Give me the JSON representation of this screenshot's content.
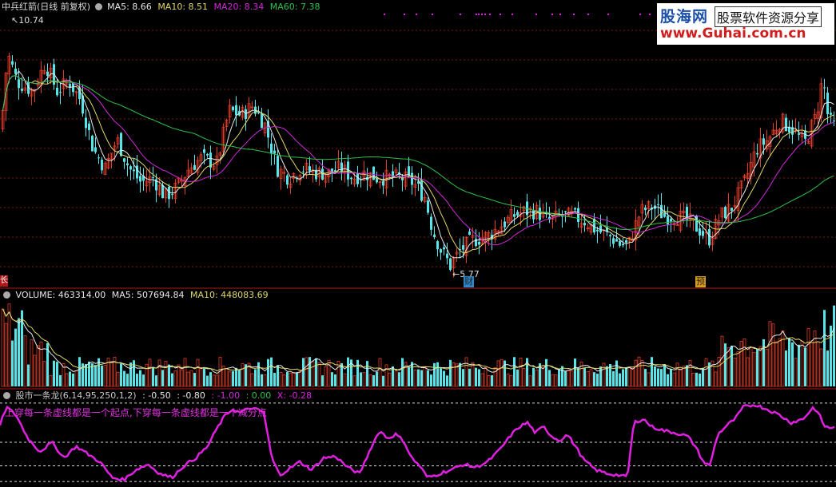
{
  "colors": {
    "background": "#000000",
    "up": "#e03e2a",
    "down": "#56e6ea",
    "ma5": "#e8e8e8",
    "ma10": "#e0d96a",
    "ma20": "#d02ad6",
    "ma60": "#2ec24a",
    "grid": "#7a1a1a",
    "divider": "#b01818",
    "indicator": "#e020e0",
    "text_gray": "#c8c8c8"
  },
  "price_panel": {
    "title": "中兵红箭(日线 前复权)",
    "ma5_label": "MA5: 8.66",
    "ma10_label": "MA10: 8.51",
    "ma20_label": "MA20: 8.34",
    "ma60_label": "MA60: 7.38",
    "high_marker": "10.74",
    "low_marker": "5.77",
    "event_cai": "财",
    "event_yu": "预",
    "corner_mark": "长"
  },
  "volume_panel": {
    "volume_label": "VOLUME: 463314.00",
    "ma5_label": "MA5: 507694.84",
    "ma10_label": "MA10: 448083.69"
  },
  "indicator_panel": {
    "name": "股市一条龙(6,14,95,250,1,2)",
    "v1": ": -0.50",
    "v2": ": -0.80",
    "v3": ": -1.00",
    "v4": ": 0.00",
    "v5": "X: -0.28",
    "note": "上穿每一条虚线都是一个起点,下穿每一条虚线都是一个减分点"
  },
  "watermark": {
    "title": "股海网",
    "slogan": "股票软件资源分享",
    "url": "www.Guhai.com.cn"
  },
  "icons": [
    "panel-toggle-icon",
    "panel-toggle-icon",
    "panel-toggle-icon"
  ],
  "chart_data": [
    {
      "type": "candlestick",
      "title": "中兵红箭(日线 前复权)",
      "series": [
        {
          "name": "MA5",
          "last": 8.66
        },
        {
          "name": "MA10",
          "last": 8.51
        },
        {
          "name": "MA20",
          "last": 8.34
        },
        {
          "name": "MA60",
          "last": 7.38
        }
      ],
      "annotations": [
        {
          "label": "10.74",
          "value": 10.74
        },
        {
          "label": "5.77",
          "value": 5.77
        }
      ],
      "anchors": [
        [
          0,
          8.6
        ],
        [
          8,
          10.2
        ],
        [
          20,
          9.6
        ],
        [
          40,
          9.4
        ],
        [
          55,
          10.0
        ],
        [
          70,
          9.4
        ],
        [
          85,
          9.6
        ],
        [
          100,
          9.2
        ],
        [
          115,
          8.2
        ],
        [
          130,
          7.8
        ],
        [
          145,
          8.4
        ],
        [
          160,
          7.8
        ],
        [
          175,
          7.5
        ],
        [
          190,
          7.6
        ],
        [
          205,
          7.2
        ],
        [
          220,
          7.4
        ],
        [
          235,
          7.8
        ],
        [
          250,
          8.0
        ],
        [
          270,
          7.9
        ],
        [
          285,
          9.0
        ],
        [
          300,
          8.9
        ],
        [
          315,
          9.1
        ],
        [
          330,
          8.7
        ],
        [
          345,
          7.8
        ],
        [
          360,
          7.6
        ],
        [
          375,
          7.8
        ],
        [
          395,
          7.7
        ],
        [
          410,
          7.7
        ],
        [
          425,
          7.8
        ],
        [
          440,
          7.6
        ],
        [
          455,
          7.7
        ],
        [
          470,
          7.6
        ],
        [
          485,
          7.6
        ],
        [
          500,
          7.6
        ],
        [
          515,
          7.5
        ],
        [
          530,
          7.2
        ],
        [
          540,
          6.5
        ],
        [
          550,
          6.1
        ],
        [
          562,
          5.77
        ],
        [
          575,
          6.1
        ],
        [
          590,
          6.3
        ],
        [
          610,
          6.4
        ],
        [
          625,
          6.6
        ],
        [
          640,
          6.8
        ],
        [
          655,
          6.9
        ],
        [
          670,
          6.9
        ],
        [
          685,
          6.7
        ],
        [
          700,
          6.8
        ],
        [
          715,
          6.8
        ],
        [
          730,
          6.7
        ],
        [
          745,
          6.5
        ],
        [
          760,
          6.4
        ],
        [
          775,
          6.2
        ],
        [
          785,
          6.2
        ],
        [
          800,
          6.9
        ],
        [
          815,
          7.0
        ],
        [
          830,
          6.8
        ],
        [
          845,
          6.8
        ],
        [
          860,
          6.7
        ],
        [
          875,
          6.5
        ],
        [
          885,
          6.3
        ],
        [
          900,
          6.8
        ],
        [
          915,
          7.0
        ],
        [
          930,
          7.5
        ],
        [
          945,
          8.2
        ],
        [
          960,
          8.4
        ],
        [
          975,
          8.8
        ],
        [
          990,
          8.6
        ],
        [
          1005,
          8.3
        ],
        [
          1020,
          8.9
        ],
        [
          1028,
          9.7
        ],
        [
          1035,
          8.8
        ],
        [
          1046,
          8.6
        ]
      ],
      "ylim": [
        5.4,
        11.0
      ]
    },
    {
      "type": "bar",
      "title": "VOLUME",
      "series": [
        {
          "name": "VOLUME",
          "last": 463314.0
        },
        {
          "name": "MA5",
          "last": 507694.84
        },
        {
          "name": "MA10",
          "last": 448083.69
        }
      ]
    },
    {
      "type": "line",
      "title": "股市一条龙(6,14,95,250,1,2)",
      "series": [
        {
          "name": "X",
          "last": -0.28
        }
      ],
      "ylim": [
        -1.05,
        0.05
      ],
      "levels": [
        0.0,
        -0.5,
        -0.8,
        -1.0
      ],
      "anchors": [
        [
          0,
          -0.28
        ],
        [
          8,
          -0.05
        ],
        [
          20,
          -0.15
        ],
        [
          35,
          -0.45
        ],
        [
          50,
          -0.62
        ],
        [
          65,
          -0.5
        ],
        [
          80,
          -0.7
        ],
        [
          95,
          -0.55
        ],
        [
          110,
          -0.65
        ],
        [
          125,
          -0.75
        ],
        [
          140,
          -0.95
        ],
        [
          155,
          -0.98
        ],
        [
          170,
          -0.85
        ],
        [
          185,
          -0.78
        ],
        [
          200,
          -0.9
        ],
        [
          215,
          -0.95
        ],
        [
          230,
          -0.8
        ],
        [
          245,
          -0.7
        ],
        [
          260,
          -0.55
        ],
        [
          270,
          -0.35
        ],
        [
          280,
          -0.18
        ],
        [
          290,
          -0.08
        ],
        [
          300,
          -0.12
        ],
        [
          315,
          -0.06
        ],
        [
          330,
          -0.12
        ],
        [
          340,
          -0.7
        ],
        [
          350,
          -0.92
        ],
        [
          360,
          -0.85
        ],
        [
          375,
          -0.75
        ],
        [
          390,
          -0.85
        ],
        [
          405,
          -0.7
        ],
        [
          420,
          -0.68
        ],
        [
          435,
          -0.82
        ],
        [
          450,
          -0.9
        ],
        [
          465,
          -0.55
        ],
        [
          475,
          -0.35
        ],
        [
          485,
          -0.45
        ],
        [
          495,
          -0.4
        ],
        [
          505,
          -0.48
        ],
        [
          515,
          -0.7
        ],
        [
          525,
          -0.8
        ],
        [
          535,
          -0.95
        ],
        [
          545,
          -0.92
        ],
        [
          555,
          -0.88
        ],
        [
          565,
          -0.85
        ],
        [
          580,
          -0.78
        ],
        [
          595,
          -0.82
        ],
        [
          610,
          -0.75
        ],
        [
          625,
          -0.6
        ],
        [
          640,
          -0.4
        ],
        [
          650,
          -0.3
        ],
        [
          660,
          -0.25
        ],
        [
          670,
          -0.38
        ],
        [
          680,
          -0.3
        ],
        [
          690,
          -0.42
        ],
        [
          700,
          -0.48
        ],
        [
          710,
          -0.4
        ],
        [
          720,
          -0.55
        ],
        [
          730,
          -0.72
        ],
        [
          745,
          -0.85
        ],
        [
          760,
          -0.9
        ],
        [
          775,
          -0.92
        ],
        [
          785,
          -0.95
        ],
        [
          793,
          -0.25
        ],
        [
          805,
          -0.2
        ],
        [
          815,
          -0.3
        ],
        [
          830,
          -0.35
        ],
        [
          845,
          -0.38
        ],
        [
          860,
          -0.42
        ],
        [
          870,
          -0.55
        ],
        [
          880,
          -0.75
        ],
        [
          888,
          -0.8
        ],
        [
          898,
          -0.4
        ],
        [
          910,
          -0.28
        ],
        [
          920,
          -0.2
        ],
        [
          930,
          -0.05
        ],
        [
          945,
          -0.02
        ],
        [
          960,
          -0.08
        ],
        [
          975,
          -0.15
        ],
        [
          990,
          -0.25
        ],
        [
          1005,
          -0.2
        ],
        [
          1018,
          -0.05
        ],
        [
          1025,
          -0.15
        ],
        [
          1032,
          -0.3
        ],
        [
          1040,
          -0.32
        ],
        [
          1046,
          -0.28
        ]
      ]
    }
  ]
}
